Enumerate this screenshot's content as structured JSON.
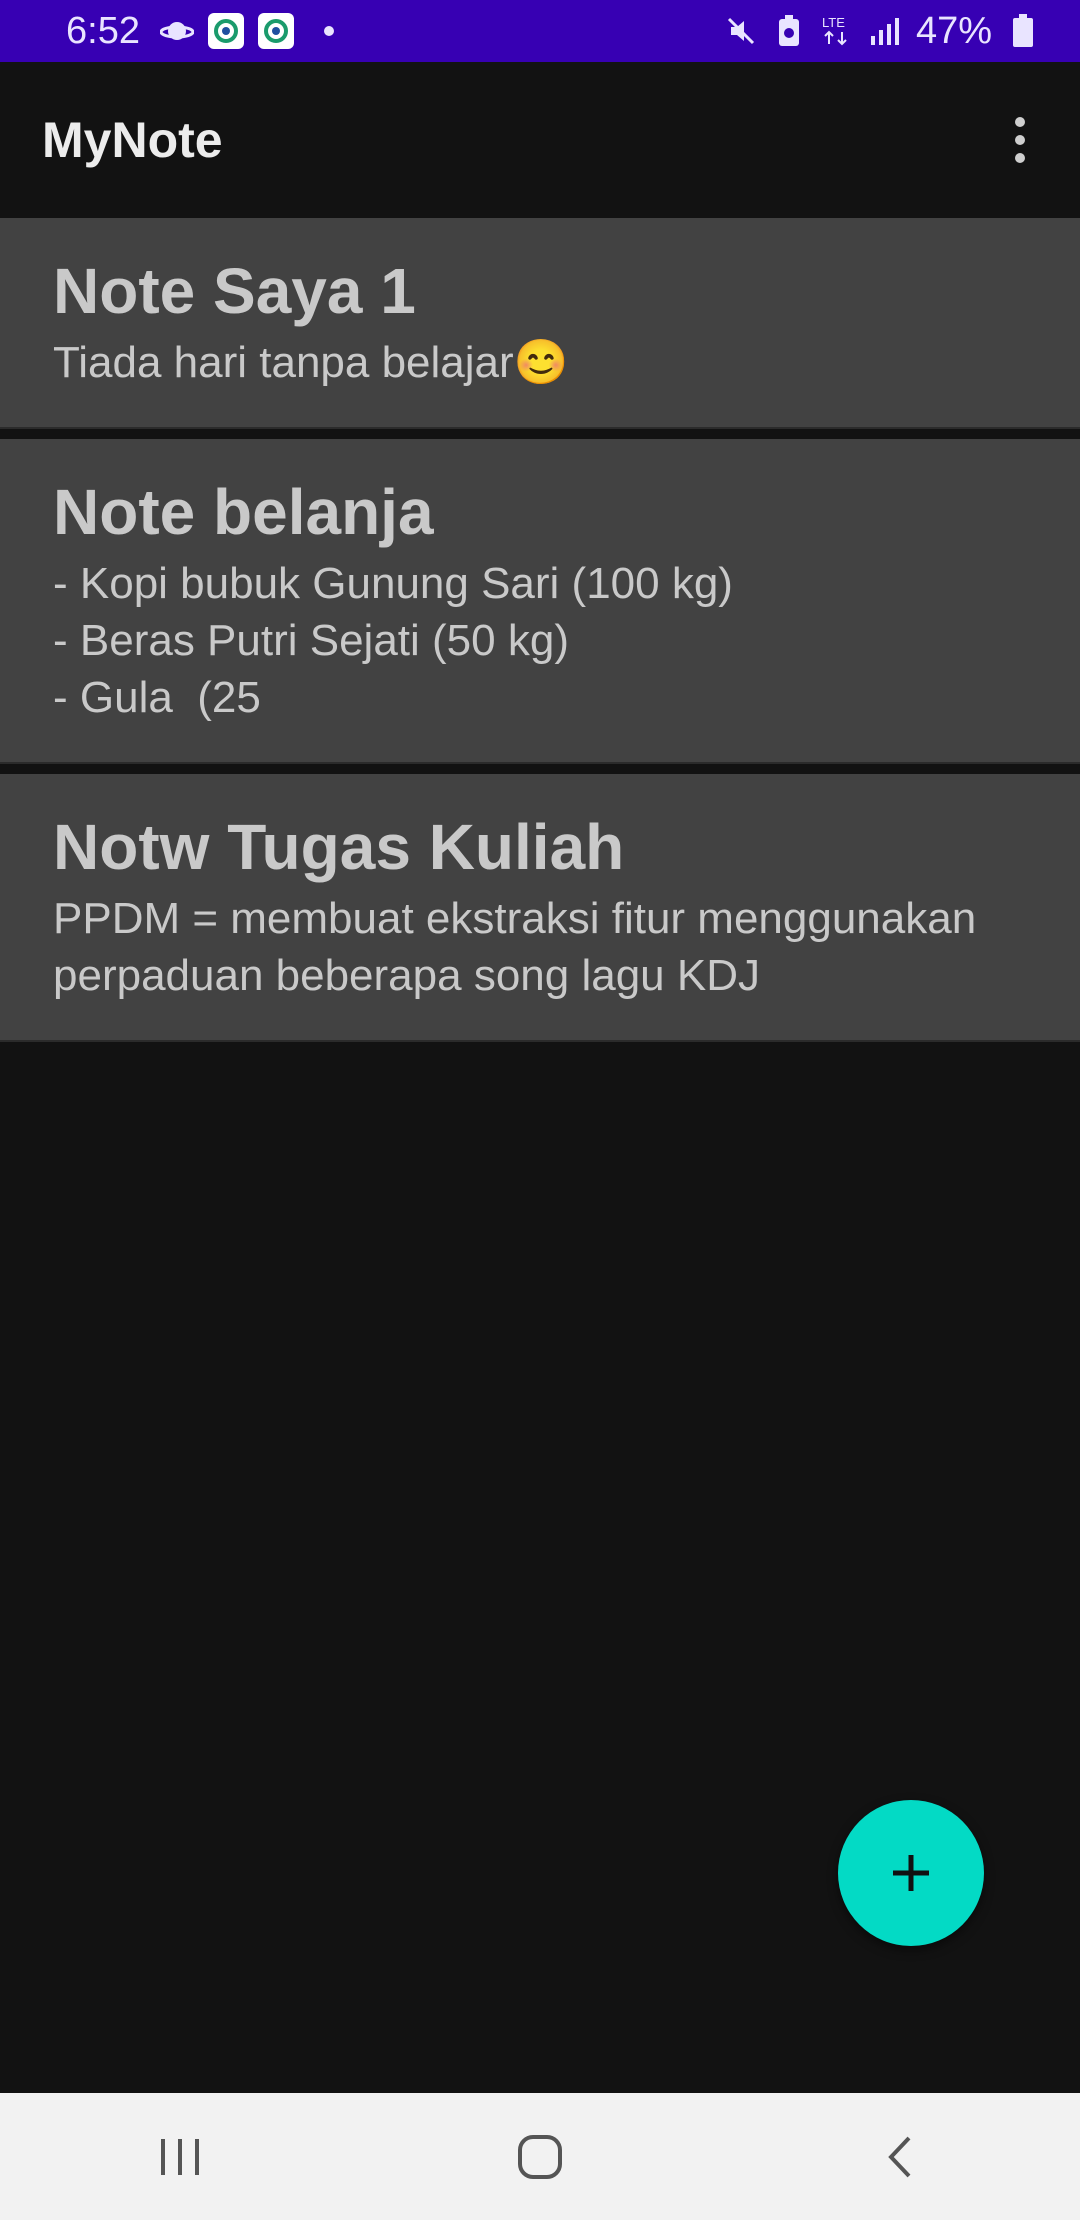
{
  "status_bar": {
    "time": "6:52",
    "battery_percent": "47%",
    "network": "LTE",
    "background_color": "#3700b3",
    "icons": [
      "saturn-icon",
      "app-notification-icon",
      "app-notification-icon",
      "dot-icon",
      "mute-icon",
      "battery-saver-icon",
      "lte-icon",
      "signal-icon",
      "battery-icon"
    ]
  },
  "app_bar": {
    "title": "MyNote",
    "menu_icon": "more-vert-icon"
  },
  "notes": [
    {
      "title": "Note Saya 1",
      "body": "Tiada hari tanpa belajar😊"
    },
    {
      "title": "Note belanja",
      "body": "- Kopi bubuk Gunung Sari (100 kg)\n- Beras Putri Sejati (50 kg)\n- Gula  (25"
    },
    {
      "title": "Notw Tugas Kuliah",
      "body": "PPDM = membuat ekstraksi fitur menggunakan perpaduan beberapa song lagu KDJ"
    }
  ],
  "fab": {
    "icon": "plus-icon",
    "color": "#03dac5"
  },
  "nav_bar": {
    "buttons": [
      "recents-icon",
      "home-icon",
      "back-icon"
    ]
  }
}
